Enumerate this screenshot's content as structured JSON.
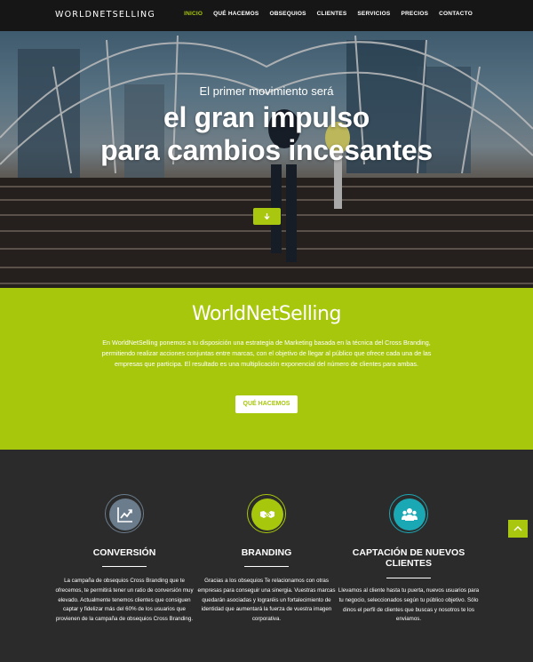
{
  "nav": {
    "brand": "WORLDNETSELLING",
    "items": [
      {
        "label": "INICIO",
        "active": true
      },
      {
        "label": "QUÉ HACEMOS",
        "active": false
      },
      {
        "label": "OBSEQUIOS",
        "active": false
      },
      {
        "label": "CLIENTES",
        "active": false
      },
      {
        "label": "SERVICIOS",
        "active": false
      },
      {
        "label": "PRECIOS",
        "active": false
      },
      {
        "label": "CONTACTO",
        "active": false
      }
    ]
  },
  "hero": {
    "subtitle": "El primer movimiento será",
    "title_line1": "el gran impulso",
    "title_line2": "para cambios incesantes",
    "scroll_icon": "arrow-down-icon"
  },
  "about": {
    "title": "WorldNetSelling",
    "text": "En WorldNetSelling ponemos a tu disposición una estrategia de Marketing basada en la técnica del Cross Branding, permitiendo realizar acciones conjuntas entre marcas, con el objetivo de llegar al público que ofrece cada una de las empresas que participa. El resultado es una multiplicación exponencial del número de clientes para ambas.",
    "button": "QUÉ HACEMOS"
  },
  "features": [
    {
      "icon": "line-chart-icon",
      "title": "CONVERSIÓN",
      "text": "La campaña de obsequios Cross Branding que te ofrecemos, te permitirá tener un ratio de conversión muy elevado. Actualmente tenemos clientes que consiguen captar y fidelizar más del 60% de los usuarios que provienen de la campaña de obsequios Cross Branding."
    },
    {
      "icon": "handshake-icon",
      "title": "BRANDING",
      "text": "Gracias a los obsequios Te relacionamos con otras empresas para conseguir una sinergia. Vuestras marcas quedarán asociadas y lograréis un fortalecimiento de identidad que aumentará la fuerza de vuestra imagen corporativa."
    },
    {
      "icon": "users-icon",
      "title": "CAPTACIÓN DE NUEVOS CLIENTES",
      "text": "Llevamos al cliente hasta tu puerta, nuevos usuarios para tu negocio, seleccionados según tu público objetivo. Sólo dinos el perfil de clientes que buscas y nosotros te los enviamos."
    }
  ],
  "scroll_top_icon": "chevron-up-icon",
  "colors": {
    "accent": "#a7c70d",
    "nav_bg": "#161616",
    "dark_bg": "#2b2b2b",
    "feature1": "#6b7c8c",
    "feature2": "#a7c70d",
    "feature3": "#1ba8b5"
  }
}
